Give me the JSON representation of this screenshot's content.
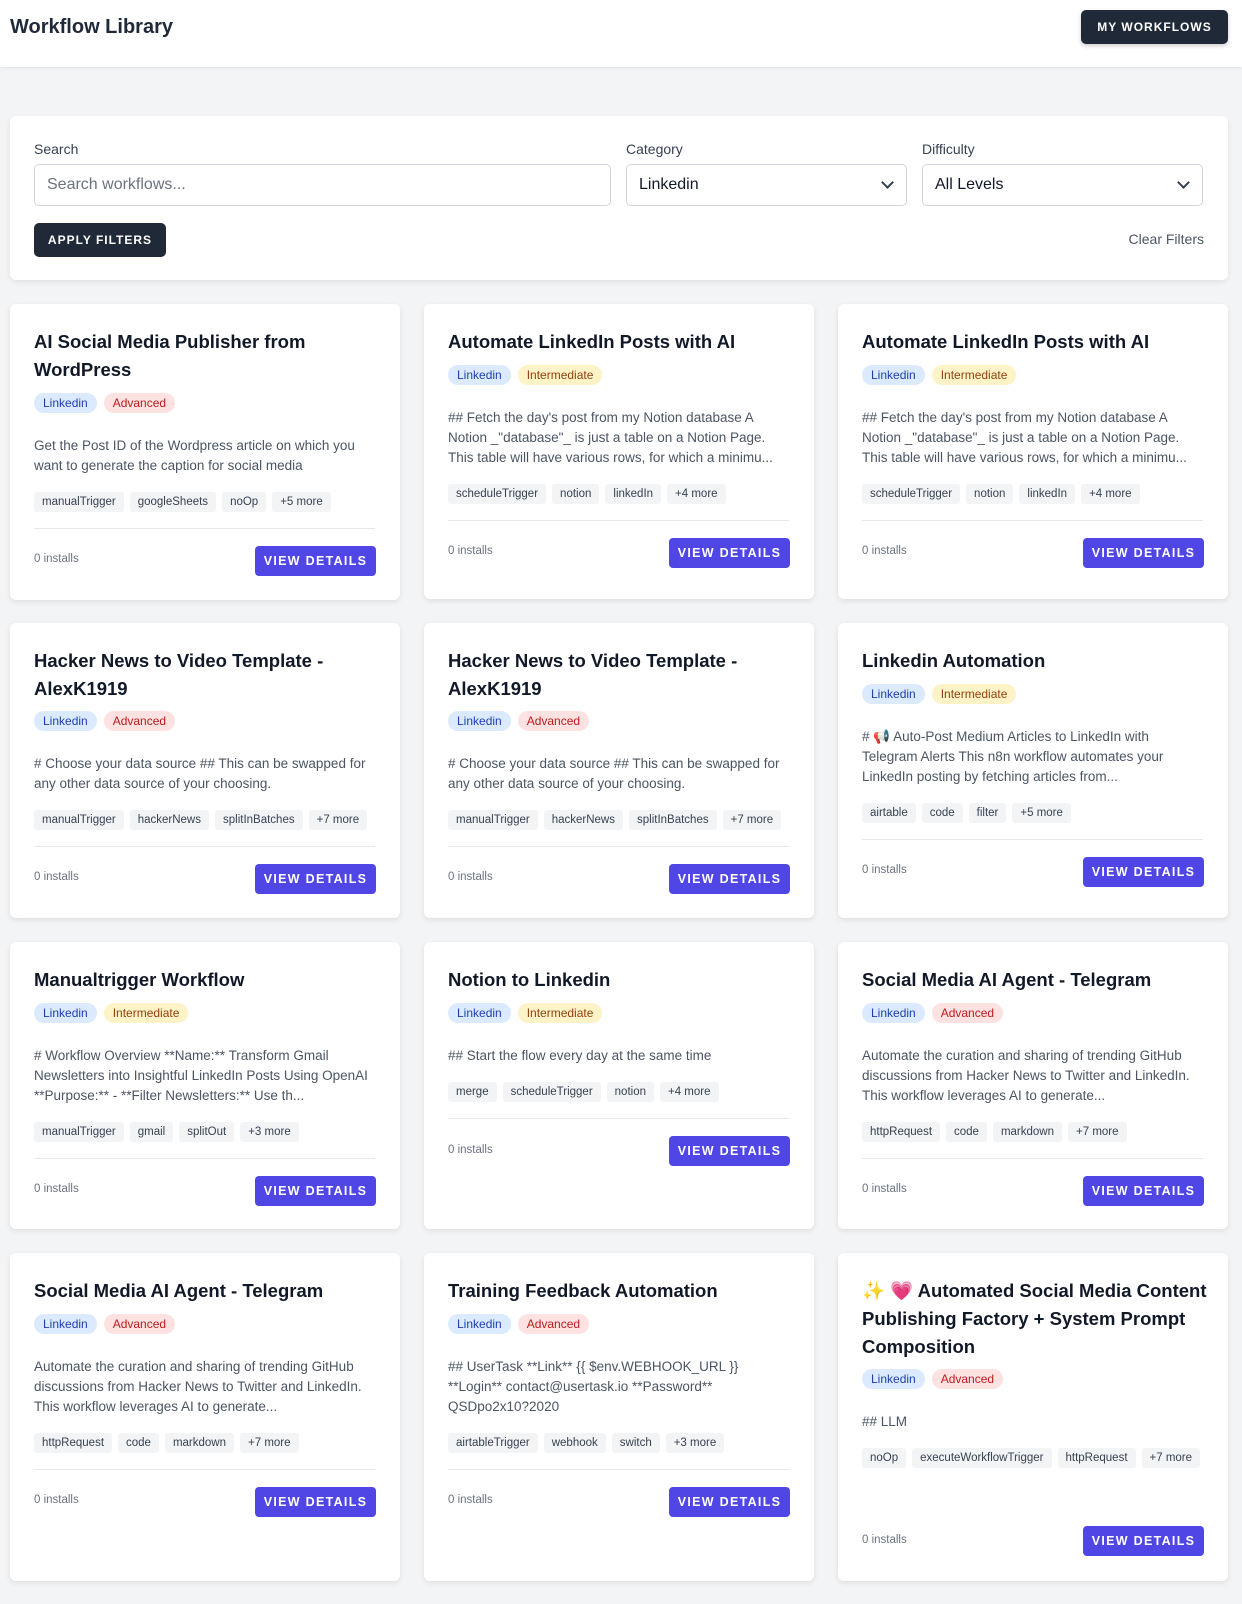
{
  "header": {
    "title": "Workflow Library",
    "my_workflows_label": "MY WORKFLOWS"
  },
  "filters": {
    "search_label": "Search",
    "search_placeholder": "Search workflows...",
    "category_label": "Category",
    "category_value": "Linkedin",
    "difficulty_label": "Difficulty",
    "difficulty_value": "All Levels",
    "apply_label": "APPLY FILTERS",
    "clear_label": "Clear Filters"
  },
  "colors": {
    "primary": "#4f46e5",
    "dark": "#1f2937",
    "badge_category": "#dbeafe",
    "badge_advanced": "#fee2e2",
    "badge_intermediate": "#fef3c7"
  },
  "cards": [
    {
      "title": "AI Social Media Publisher from WordPress",
      "category": "Linkedin",
      "difficulty": "Advanced",
      "description": "Get the Post ID of the Wordpress article on which you want to generate the caption for social media",
      "tags": [
        "manualTrigger",
        "googleSheets",
        "noOp",
        "+5 more"
      ],
      "installs": "0 installs",
      "button": "VIEW DETAILS"
    },
    {
      "title": "Automate LinkedIn Posts with AI",
      "category": "Linkedin",
      "difficulty": "Intermediate",
      "description": "## Fetch the day's post from my Notion database A Notion _\"database\"_ is just a table on a Notion Page. This table will have various rows, for which a minimu...",
      "tags": [
        "scheduleTrigger",
        "notion",
        "linkedIn",
        "+4 more"
      ],
      "installs": "0 installs",
      "button": "VIEW DETAILS"
    },
    {
      "title": "Automate LinkedIn Posts with AI",
      "category": "Linkedin",
      "difficulty": "Intermediate",
      "description": "## Fetch the day's post from my Notion database A Notion _\"database\"_ is just a table on a Notion Page. This table will have various rows, for which a minimu...",
      "tags": [
        "scheduleTrigger",
        "notion",
        "linkedIn",
        "+4 more"
      ],
      "installs": "0 installs",
      "button": "VIEW DETAILS"
    },
    {
      "title": "Hacker News to Video Template - AlexK1919",
      "category": "Linkedin",
      "difficulty": "Advanced",
      "description": "# Choose your data source ## This can be swapped for any other data source of your choosing.",
      "tags": [
        "manualTrigger",
        "hackerNews",
        "splitInBatches",
        "+7 more"
      ],
      "installs": "0 installs",
      "button": "VIEW DETAILS"
    },
    {
      "title": "Hacker News to Video Template - AlexK1919",
      "category": "Linkedin",
      "difficulty": "Advanced",
      "description": "# Choose your data source ## This can be swapped for any other data source of your choosing.",
      "tags": [
        "manualTrigger",
        "hackerNews",
        "splitInBatches",
        "+7 more"
      ],
      "installs": "0 installs",
      "button": "VIEW DETAILS"
    },
    {
      "title": "Linkedin Automation",
      "category": "Linkedin",
      "difficulty": "Intermediate",
      "description": "# 📢 Auto-Post Medium Articles to LinkedIn with Telegram Alerts This n8n workflow automates your LinkedIn posting by fetching articles from...",
      "tags": [
        "airtable",
        "code",
        "filter",
        "+5 more"
      ],
      "installs": "0 installs",
      "button": "VIEW DETAILS"
    },
    {
      "title": "Manualtrigger Workflow",
      "category": "Linkedin",
      "difficulty": "Intermediate",
      "description": "# Workflow Overview **Name:** Transform Gmail Newsletters into Insightful LinkedIn Posts Using OpenAI **Purpose:** - **Filter Newsletters:** Use th...",
      "tags": [
        "manualTrigger",
        "gmail",
        "splitOut",
        "+3 more"
      ],
      "installs": "0 installs",
      "button": "VIEW DETAILS"
    },
    {
      "title": "Notion to Linkedin",
      "category": "Linkedin",
      "difficulty": "Intermediate",
      "description": "## Start the flow every day at the same time",
      "tags": [
        "merge",
        "scheduleTrigger",
        "notion",
        "+4 more"
      ],
      "installs": "0 installs",
      "button": "VIEW DETAILS"
    },
    {
      "title": "Social Media AI Agent - Telegram",
      "category": "Linkedin",
      "difficulty": "Advanced",
      "description": "Automate the curation and sharing of trending GitHub discussions from Hacker News to Twitter and LinkedIn. This workflow leverages AI to generate...",
      "tags": [
        "httpRequest",
        "code",
        "markdown",
        "+7 more"
      ],
      "installs": "0 installs",
      "button": "VIEW DETAILS"
    },
    {
      "title": "Social Media AI Agent - Telegram",
      "category": "Linkedin",
      "difficulty": "Advanced",
      "description": "Automate the curation and sharing of trending GitHub discussions from Hacker News to Twitter and LinkedIn. This workflow leverages AI to generate...",
      "tags": [
        "httpRequest",
        "code",
        "markdown",
        "+7 more"
      ],
      "installs": "0 installs",
      "button": "VIEW DETAILS"
    },
    {
      "title": "Training Feedback Automation",
      "category": "Linkedin",
      "difficulty": "Advanced",
      "description": "## UserTask **Link** {{ $env.WEBHOOK_URL }} **Login** contact@usertask.io **Password** QSDpo2x10?2020",
      "tags": [
        "airtableTrigger",
        "webhook",
        "switch",
        "+3 more"
      ],
      "installs": "0 installs",
      "button": "VIEW DETAILS"
    },
    {
      "title": "✨ 💗 Automated Social Media Content Publishing Factory + System Prompt Composition",
      "category": "Linkedin",
      "difficulty": "Advanced",
      "description": "## LLM",
      "tags": [
        "noOp",
        "executeWorkflowTrigger",
        "httpRequest",
        "+7 more"
      ],
      "installs": "0 installs",
      "button": "VIEW DETAILS"
    }
  ]
}
